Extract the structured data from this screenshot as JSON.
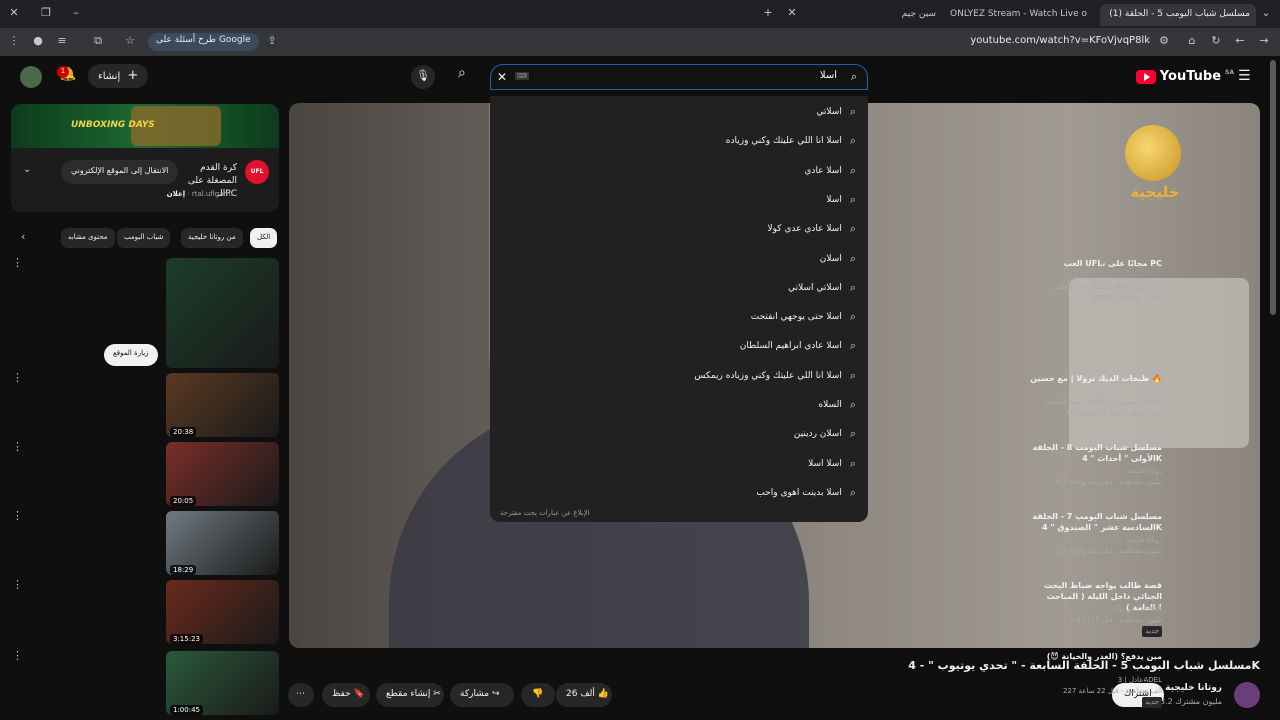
{
  "browser": {
    "tabs": [
      {
        "title": "(1) مسلسل شباب البومب 5 - الحلقة",
        "active": true
      },
      {
        "title": "ONLYEZ Stream - Watch Live o"
      },
      {
        "title": "سين جيم"
      }
    ],
    "url": "youtube.com/watch?v=KFoVjvqP8lk",
    "ask_google": "طرح أسئلة على Google"
  },
  "header": {
    "logo": "YouTube",
    "logo_region": "SA",
    "create_label": "إنشاء",
    "notif_count": "1",
    "search_query": "اسلا"
  },
  "suggestions": [
    "اسلاتي",
    "اسلا انا اللي عليتك وكني وزياده",
    "اسلا عادي",
    "اسلا",
    "اسلا عادي عدي كولا",
    "اسلان",
    "اسلاتي اسلاتي",
    "اسلا حتى يوجهي انفتحت",
    "اسلا عادي ابراهيم السلطان",
    "اسلا انا اللي عليتك وكني وزياده ريمكس",
    "السلاه",
    "اسلان ردينين",
    "اسلا اسلا",
    "اسلا بدينت اهوى واحب"
  ],
  "suggestions_footer": "الإبلاغ عن عبارات بحث مقترحة",
  "video": {
    "title": "مسلسل شباب البومب 5 - الحلقة السابعة - \" تحدي يوتيوب \" - 4K",
    "channel": "روتانا خليجية",
    "subscribers": "13.2 مليون مشترك",
    "subscribe": "اشتراك",
    "likes": "26 ألف",
    "share": "مشاركة",
    "clip": "إنشاء مقطع",
    "save": "حفظ",
    "channel_logo_text": "خليجية"
  },
  "ad": {
    "banner": "UNBOXING DAYS",
    "title": "كرة القدم المصغلة على الـPC",
    "sponsor_tag": "إعلان",
    "sponsor_url": "rtal.uflgam...",
    "cta": "الانتقال إلى الموقع الإلكتروني",
    "logo": "UFL"
  },
  "chips": [
    "الكل",
    "من روتانا خليجية",
    "شباب البومب",
    "محتوى مشابه"
  ],
  "related": [
    {
      "title": "العب UFL، مجانًا على PC",
      "meta1": "ابن فريق الأحلام وسيطر على الملعب.",
      "meta2": "XTEN Limited · إعلان",
      "duration": "",
      "visit": "زيارة الموقع",
      "thumb": "#1c3d2a"
    },
    {
      "title": "طبخات الديك ترولا | مع حسين 🔥",
      "meta1": "محمد العامدي | JERY وحسين | 7SNEN",
      "meta2": "442 ألف مشاهدة · قبل 4 أسابيع",
      "duration": "20:38",
      "thumb": "#5a3a22"
    },
    {
      "title": "مسلسل شباب البومب 8 - الحلقة الأولى \" أحداث \" 4K",
      "meta1": "روتانا خليجية",
      "meta2": "4.7 مليون مشاهدة · قبل سنة واحدة",
      "duration": "20:05",
      "thumb": "#7a2e28"
    },
    {
      "title": "مسلسل شباب البومب 7 - الحلقة السادسة عشر \" الصندوق \" 4K",
      "meta1": "روتانا خليجية",
      "meta2": "1.3 مليون مشاهدة · قبل سنة واحدة",
      "duration": "18:29",
      "thumb": "#6f7a80"
    },
    {
      "title": "قصة طالب يواجه ضباط البحث الجنائي داخل الليلة ( المباحث العامة ) !",
      "meta1": "في وار / VWAR",
      "meta2": "1.5 مليون مشاهدة · قبل 5 أيام",
      "duration": "3:15:23",
      "thumb": "#6b2a1c"
    },
    {
      "title": "مين يدفع؟ (الغدر والخيانة 😈)",
      "meta1": "عادل | 3ADEL",
      "meta2": "227 ألف مشاهدة · قبل 22 ساعة",
      "duration": "1:00:45",
      "thumb": "#2a5a3a"
    }
  ],
  "new_badge": "جديد"
}
